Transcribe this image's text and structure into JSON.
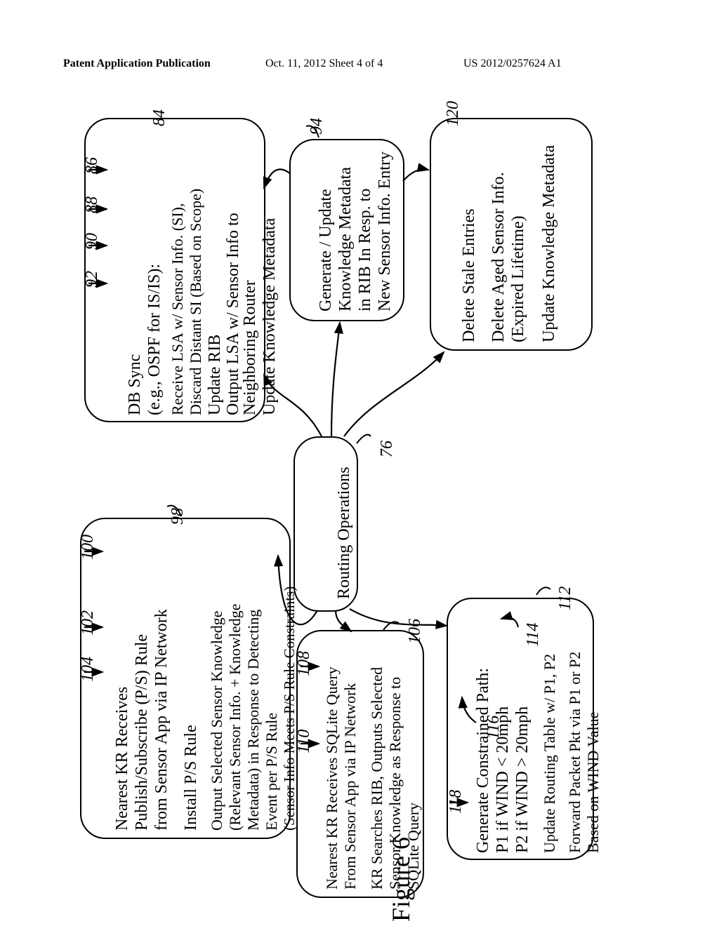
{
  "header": {
    "left": "Patent Application Publication",
    "center": "Oct. 11, 2012   Sheet 4 of 4",
    "right": "US 2012/0257624 A1"
  },
  "caption": "Figure 6",
  "refs": {
    "r84": "84",
    "r86": "86",
    "r88": "88",
    "r90": "90",
    "r92": "92",
    "r94": "94",
    "r76": "76",
    "r98": "98",
    "r100": "100",
    "r102": "102",
    "r104": "104",
    "r106": "106",
    "r108": "108",
    "r110": "110",
    "r112": "112",
    "r114": "114",
    "r116": "116",
    "r118": "118",
    "r120": "120"
  },
  "box84": {
    "l1": "DB Sync",
    "l2": "(e.g., OSPF for IS/IS):",
    "l3": "Receive LSA w/ Sensor Info. (SI),",
    "l4": "Discard Distant SI (Based on Scope)",
    "l5": "Update RIB",
    "l6": "Output LSA w/ Sensor Info to",
    "l7": "Neighboring Router",
    "l8": "Update Knowledge Metadata"
  },
  "box94": {
    "l1": "Generate / Update",
    "l2": "Knowledge Metadata",
    "l3": "in RIB In Resp. to",
    "l4": "New Sensor Info. Entry"
  },
  "box120": {
    "l1": "Delete Stale Entries",
    "l2": "Delete Aged Sensor Info.",
    "l3": "(Expired Lifetime)",
    "l4": "Update Knowledge Metadata"
  },
  "ops": {
    "title": "Routing Operations"
  },
  "box98": {
    "l1": "Nearest KR Receives",
    "l2": "Publish/Subscribe (P/S) Rule",
    "l3": "from Sensor App via IP Network",
    "l4": "Install P/S Rule",
    "l5": "Output Selected Sensor Knowledge",
    "l6": "(Relevant Sensor Info. + Knowledge",
    "l7": "Metadata) in Response to Detecting",
    "l8": "Event per P/S Rule",
    "l9": "(Sensor Info Meets P/S Rule Constraints)"
  },
  "box106": {
    "l1": "Nearest KR Receives SQLite Query",
    "l2": "From Sensor App via IP Network",
    "l3": "KR Searches RIB, Outputs Selected",
    "l4": "Sensor Knowledge as Response to",
    "l5": "SQLite Query"
  },
  "box112": {
    "l1": "Generate Constrained Path:",
    "l2": "P1 if WIND < 20mph",
    "l3": "P2 if WIND > 20mph",
    "l4": "Update Routing Table w/ P1, P2",
    "l5": "Forward Packet Pkt via P1 or P2",
    "l6": "Based on WIND Value"
  }
}
